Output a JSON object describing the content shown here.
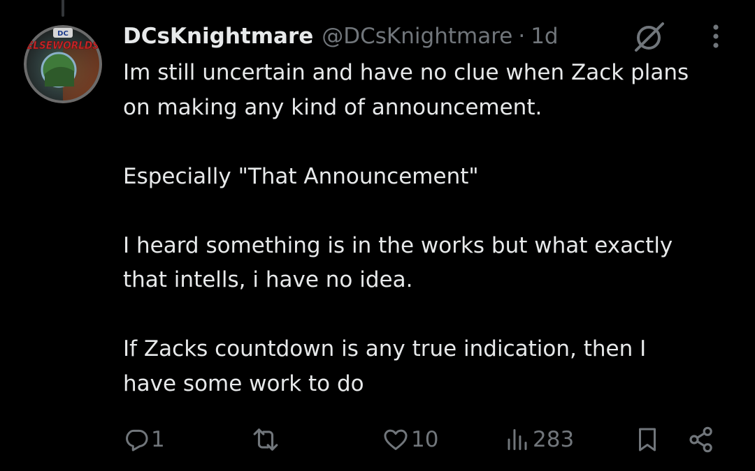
{
  "tweet": {
    "display_name": "DCsKnightmare",
    "handle": "@DCsKnightmare",
    "separator": "·",
    "time": "1d",
    "avatar_text": "ELSEWORLDS",
    "avatar_badge": "DC",
    "paragraphs": [
      [
        "Im still uncertain and have no clue when Zack plans",
        "on making any kind of announcement."
      ],
      [
        "Especially \"That Announcement\""
      ],
      [
        "I heard something is in the works but what exactly",
        "that intells, i have no idea."
      ],
      [
        "If Zacks countdown is any true indication, then I",
        "have some work to do"
      ]
    ]
  },
  "actions": {
    "reply_count": "1",
    "retweet_count": "",
    "like_count": "10",
    "view_count": "283"
  },
  "icons": {
    "grok": "grok-icon",
    "more": "more-vertical-icon",
    "reply": "reply-icon",
    "retweet": "retweet-icon",
    "like": "heart-icon",
    "views": "views-icon",
    "bookmark": "bookmark-icon",
    "share": "share-icon"
  },
  "colors": {
    "background": "#000000",
    "text": "#e7e9ea",
    "secondary": "#71767b"
  }
}
